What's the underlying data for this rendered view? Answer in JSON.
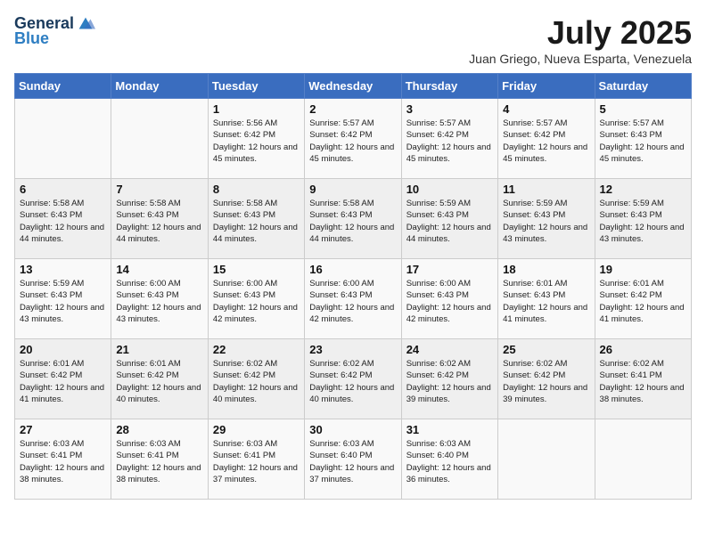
{
  "header": {
    "logo_general": "General",
    "logo_blue": "Blue",
    "title": "July 2025",
    "location": "Juan Griego, Nueva Esparta, Venezuela"
  },
  "weekdays": [
    "Sunday",
    "Monday",
    "Tuesday",
    "Wednesday",
    "Thursday",
    "Friday",
    "Saturday"
  ],
  "weeks": [
    [
      {
        "day": "",
        "sunrise": "",
        "sunset": "",
        "daylight": ""
      },
      {
        "day": "",
        "sunrise": "",
        "sunset": "",
        "daylight": ""
      },
      {
        "day": "1",
        "sunrise": "Sunrise: 5:56 AM",
        "sunset": "Sunset: 6:42 PM",
        "daylight": "Daylight: 12 hours and 45 minutes."
      },
      {
        "day": "2",
        "sunrise": "Sunrise: 5:57 AM",
        "sunset": "Sunset: 6:42 PM",
        "daylight": "Daylight: 12 hours and 45 minutes."
      },
      {
        "day": "3",
        "sunrise": "Sunrise: 5:57 AM",
        "sunset": "Sunset: 6:42 PM",
        "daylight": "Daylight: 12 hours and 45 minutes."
      },
      {
        "day": "4",
        "sunrise": "Sunrise: 5:57 AM",
        "sunset": "Sunset: 6:42 PM",
        "daylight": "Daylight: 12 hours and 45 minutes."
      },
      {
        "day": "5",
        "sunrise": "Sunrise: 5:57 AM",
        "sunset": "Sunset: 6:43 PM",
        "daylight": "Daylight: 12 hours and 45 minutes."
      }
    ],
    [
      {
        "day": "6",
        "sunrise": "Sunrise: 5:58 AM",
        "sunset": "Sunset: 6:43 PM",
        "daylight": "Daylight: 12 hours and 44 minutes."
      },
      {
        "day": "7",
        "sunrise": "Sunrise: 5:58 AM",
        "sunset": "Sunset: 6:43 PM",
        "daylight": "Daylight: 12 hours and 44 minutes."
      },
      {
        "day": "8",
        "sunrise": "Sunrise: 5:58 AM",
        "sunset": "Sunset: 6:43 PM",
        "daylight": "Daylight: 12 hours and 44 minutes."
      },
      {
        "day": "9",
        "sunrise": "Sunrise: 5:58 AM",
        "sunset": "Sunset: 6:43 PM",
        "daylight": "Daylight: 12 hours and 44 minutes."
      },
      {
        "day": "10",
        "sunrise": "Sunrise: 5:59 AM",
        "sunset": "Sunset: 6:43 PM",
        "daylight": "Daylight: 12 hours and 44 minutes."
      },
      {
        "day": "11",
        "sunrise": "Sunrise: 5:59 AM",
        "sunset": "Sunset: 6:43 PM",
        "daylight": "Daylight: 12 hours and 43 minutes."
      },
      {
        "day": "12",
        "sunrise": "Sunrise: 5:59 AM",
        "sunset": "Sunset: 6:43 PM",
        "daylight": "Daylight: 12 hours and 43 minutes."
      }
    ],
    [
      {
        "day": "13",
        "sunrise": "Sunrise: 5:59 AM",
        "sunset": "Sunset: 6:43 PM",
        "daylight": "Daylight: 12 hours and 43 minutes."
      },
      {
        "day": "14",
        "sunrise": "Sunrise: 6:00 AM",
        "sunset": "Sunset: 6:43 PM",
        "daylight": "Daylight: 12 hours and 43 minutes."
      },
      {
        "day": "15",
        "sunrise": "Sunrise: 6:00 AM",
        "sunset": "Sunset: 6:43 PM",
        "daylight": "Daylight: 12 hours and 42 minutes."
      },
      {
        "day": "16",
        "sunrise": "Sunrise: 6:00 AM",
        "sunset": "Sunset: 6:43 PM",
        "daylight": "Daylight: 12 hours and 42 minutes."
      },
      {
        "day": "17",
        "sunrise": "Sunrise: 6:00 AM",
        "sunset": "Sunset: 6:43 PM",
        "daylight": "Daylight: 12 hours and 42 minutes."
      },
      {
        "day": "18",
        "sunrise": "Sunrise: 6:01 AM",
        "sunset": "Sunset: 6:43 PM",
        "daylight": "Daylight: 12 hours and 41 minutes."
      },
      {
        "day": "19",
        "sunrise": "Sunrise: 6:01 AM",
        "sunset": "Sunset: 6:42 PM",
        "daylight": "Daylight: 12 hours and 41 minutes."
      }
    ],
    [
      {
        "day": "20",
        "sunrise": "Sunrise: 6:01 AM",
        "sunset": "Sunset: 6:42 PM",
        "daylight": "Daylight: 12 hours and 41 minutes."
      },
      {
        "day": "21",
        "sunrise": "Sunrise: 6:01 AM",
        "sunset": "Sunset: 6:42 PM",
        "daylight": "Daylight: 12 hours and 40 minutes."
      },
      {
        "day": "22",
        "sunrise": "Sunrise: 6:02 AM",
        "sunset": "Sunset: 6:42 PM",
        "daylight": "Daylight: 12 hours and 40 minutes."
      },
      {
        "day": "23",
        "sunrise": "Sunrise: 6:02 AM",
        "sunset": "Sunset: 6:42 PM",
        "daylight": "Daylight: 12 hours and 40 minutes."
      },
      {
        "day": "24",
        "sunrise": "Sunrise: 6:02 AM",
        "sunset": "Sunset: 6:42 PM",
        "daylight": "Daylight: 12 hours and 39 minutes."
      },
      {
        "day": "25",
        "sunrise": "Sunrise: 6:02 AM",
        "sunset": "Sunset: 6:42 PM",
        "daylight": "Daylight: 12 hours and 39 minutes."
      },
      {
        "day": "26",
        "sunrise": "Sunrise: 6:02 AM",
        "sunset": "Sunset: 6:41 PM",
        "daylight": "Daylight: 12 hours and 38 minutes."
      }
    ],
    [
      {
        "day": "27",
        "sunrise": "Sunrise: 6:03 AM",
        "sunset": "Sunset: 6:41 PM",
        "daylight": "Daylight: 12 hours and 38 minutes."
      },
      {
        "day": "28",
        "sunrise": "Sunrise: 6:03 AM",
        "sunset": "Sunset: 6:41 PM",
        "daylight": "Daylight: 12 hours and 38 minutes."
      },
      {
        "day": "29",
        "sunrise": "Sunrise: 6:03 AM",
        "sunset": "Sunset: 6:41 PM",
        "daylight": "Daylight: 12 hours and 37 minutes."
      },
      {
        "day": "30",
        "sunrise": "Sunrise: 6:03 AM",
        "sunset": "Sunset: 6:40 PM",
        "daylight": "Daylight: 12 hours and 37 minutes."
      },
      {
        "day": "31",
        "sunrise": "Sunrise: 6:03 AM",
        "sunset": "Sunset: 6:40 PM",
        "daylight": "Daylight: 12 hours and 36 minutes."
      },
      {
        "day": "",
        "sunrise": "",
        "sunset": "",
        "daylight": ""
      },
      {
        "day": "",
        "sunrise": "",
        "sunset": "",
        "daylight": ""
      }
    ]
  ]
}
